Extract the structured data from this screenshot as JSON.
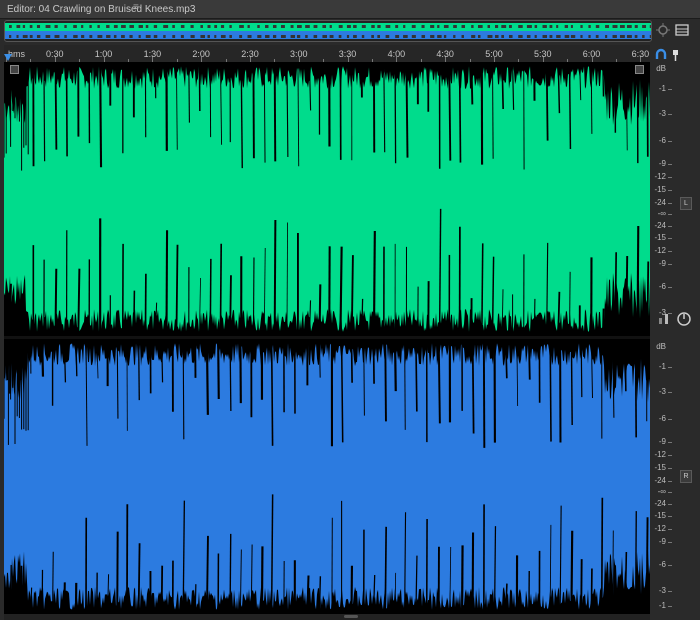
{
  "editor": {
    "title": "Editor: 04 Crawling on Bruised Knees.mp3",
    "menu_icon": "hamburger-menu-icon"
  },
  "ruler": {
    "unit": "hms",
    "labels": [
      "0:30",
      "1:00",
      "1:30",
      "2:00",
      "2:30",
      "3:00",
      "3:30",
      "4:00",
      "4:30",
      "5:00",
      "5:30",
      "6:00",
      "6:30"
    ]
  },
  "db_scale": {
    "unit": "dB",
    "upper": [
      "-1",
      "-3",
      "-6",
      "-9",
      "-12",
      "-15",
      "-24",
      "-∞",
      "-24",
      "-15",
      "-12",
      "-9",
      "-6",
      "-3",
      "-1"
    ],
    "left_labels": [
      "-1",
      "-3",
      "-6",
      "-9",
      "-12",
      "-15",
      "-24",
      "-∞",
      "-24",
      "-15",
      "-12",
      "-9",
      "-6",
      "-3"
    ],
    "right_labels": [
      "-1",
      "-3",
      "-6",
      "-9",
      "-12",
      "-15",
      "-24",
      "-∞",
      "-24",
      "-15",
      "-12",
      "-9",
      "-6",
      "-3",
      "-1"
    ]
  },
  "channels": {
    "left": {
      "button": "L",
      "color": "#00dc8c"
    },
    "right": {
      "button": "R",
      "color": "#2c7be0"
    }
  },
  "colors": {
    "background": "#2a2a2a",
    "accent": "#3a8ee6",
    "left_wave": "#00dc8c",
    "right_wave": "#2c7be0"
  },
  "icons": {
    "zoom": "zoom-icon",
    "panel": "panel-menu-icon",
    "snap": "snap-magnet-icon",
    "marker": "marker-pin-icon",
    "volume": "volume-knob-icon",
    "gain": "gain-slider-icon"
  }
}
